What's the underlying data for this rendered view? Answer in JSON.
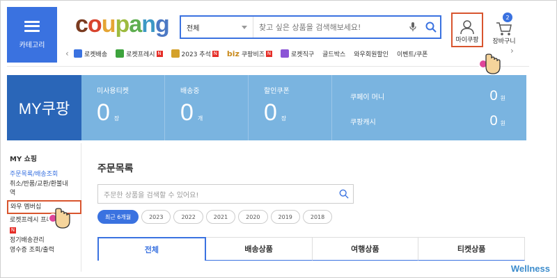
{
  "header": {
    "category_label": "카테고리",
    "logo": {
      "letters": [
        {
          "ch": "c",
          "color": "#7a3b20"
        },
        {
          "ch": "o",
          "color": "#d8442e"
        },
        {
          "ch": "u",
          "color": "#e5a534"
        },
        {
          "ch": "p",
          "color": "#9dbb3f"
        },
        {
          "ch": "a",
          "color": "#5fae50"
        },
        {
          "ch": "n",
          "color": "#3d98c5"
        },
        {
          "ch": "g",
          "color": "#4c79c4"
        }
      ]
    },
    "search": {
      "scope": "전체",
      "placeholder": "찾고 싶은 상품을 검색해보세요!"
    },
    "mypage_label": "마이쿠팡",
    "cart_label": "장바구니",
    "cart_count": "2"
  },
  "quick_links": [
    {
      "label": "로켓배송",
      "icon": "rocket-icon",
      "color": "#3a72e0",
      "new": false
    },
    {
      "label": "로켓프레시",
      "icon": "rocket-fresh-icon",
      "color": "#3da33d",
      "new": true
    },
    {
      "label": "2023 추석",
      "icon": "chuseok-icon",
      "color": "#d4a12b",
      "new": true
    },
    {
      "label": "쿠팡비즈",
      "icon": "biz-icon",
      "color": "#c98a1c",
      "new": true,
      "prefix": "biz"
    },
    {
      "label": "로켓직구",
      "icon": "global-icon",
      "color": "#8b55d6",
      "new": false
    },
    {
      "label": "골드박스",
      "icon": "",
      "color": "",
      "new": false
    },
    {
      "label": "와우회원할인",
      "icon": "",
      "color": "",
      "new": false
    },
    {
      "label": "이벤트/쿠폰",
      "icon": "",
      "color": "",
      "new": false
    }
  ],
  "banner": {
    "title": "MY쿠팡",
    "stats": [
      {
        "label": "미사용티켓",
        "value": "0",
        "unit": "장"
      },
      {
        "label": "배송중",
        "value": "0",
        "unit": "개"
      },
      {
        "label": "할인쿠폰",
        "value": "0",
        "unit": "장"
      }
    ],
    "money": [
      {
        "label": "쿠페이 머니",
        "value": "0",
        "unit": "원"
      },
      {
        "label": "쿠팡캐시",
        "value": "0",
        "unit": "원"
      }
    ]
  },
  "sidebar": {
    "heading": "MY 쇼핑",
    "links": [
      "주문목록/배송조회",
      "취소/반품/교환/환불내역",
      "와우 멤버십",
      "로켓프레시 프레시백",
      "정기배송관리",
      "영수증 조회/출력"
    ]
  },
  "main": {
    "title": "주문목록",
    "search_placeholder": "주문한 상품을 검색할 수 있어요!",
    "chips": [
      "최근 6개월",
      "2023",
      "2022",
      "2021",
      "2020",
      "2019",
      "2018"
    ],
    "tabs": [
      "전체",
      "배송상품",
      "여행상품",
      "티켓상품"
    ]
  },
  "watermark": "Wellness"
}
